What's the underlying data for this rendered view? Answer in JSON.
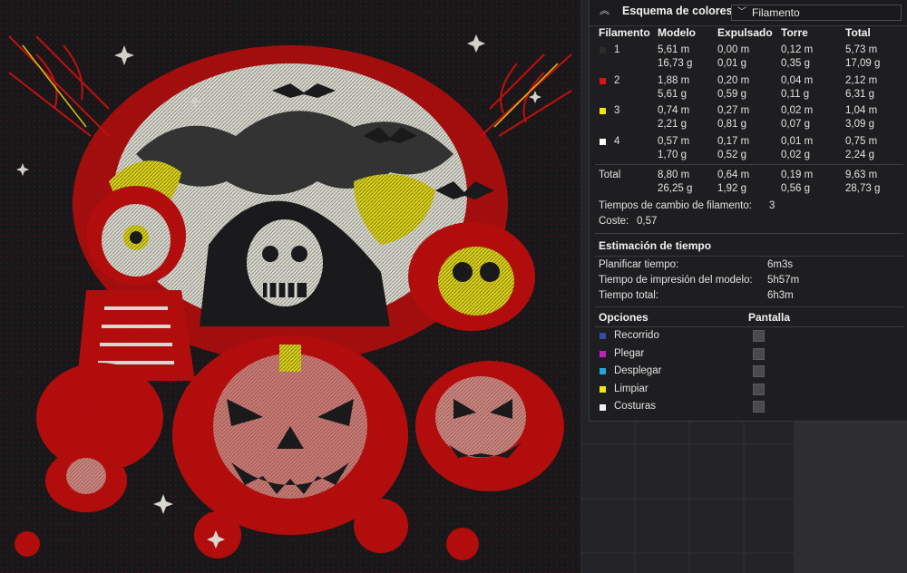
{
  "legend": {
    "title": "Esquema de colores",
    "view_mode": "Filamento",
    "headers": [
      "Filamento",
      "Modelo",
      "Expulsado",
      "Torre",
      "Total"
    ],
    "filaments": [
      {
        "id": "1",
        "color": "#2b2b2b",
        "modelo": [
          "5,61 m",
          "16,73 g"
        ],
        "expulsado": [
          "0,00 m",
          "0,01 g"
        ],
        "torre": [
          "0,12 m",
          "0,35 g"
        ],
        "total": [
          "5,73 m",
          "17,09 g"
        ]
      },
      {
        "id": "2",
        "color": "#e01010",
        "modelo": [
          "1,88 m",
          "5,61 g"
        ],
        "expulsado": [
          "0,20 m",
          "0,59 g"
        ],
        "torre": [
          "0,04 m",
          "0,11 g"
        ],
        "total": [
          "2,12 m",
          "6,31 g"
        ]
      },
      {
        "id": "3",
        "color": "#f2e600",
        "modelo": [
          "0,74 m",
          "2,21 g"
        ],
        "expulsado": [
          "0,27 m",
          "0,81 g"
        ],
        "torre": [
          "0,02 m",
          "0,07 g"
        ],
        "total": [
          "1,04 m",
          "3,09 g"
        ]
      },
      {
        "id": "4",
        "color": "#ffffff",
        "modelo": [
          "0,57 m",
          "1,70 g"
        ],
        "expulsado": [
          "0,17 m",
          "0,52 g"
        ],
        "torre": [
          "0,01 m",
          "0,02 g"
        ],
        "total": [
          "0,75 m",
          "2,24 g"
        ]
      }
    ],
    "total_row": {
      "label": "Total",
      "modelo": [
        "8,80 m",
        "26,25 g"
      ],
      "expulsado": [
        "0,64 m",
        "1,92 g"
      ],
      "torre": [
        "0,19 m",
        "0,56 g"
      ],
      "total": [
        "9,63 m",
        "28,73 g"
      ]
    },
    "filament_changes_label": "Tiempos de cambio de filamento:",
    "filament_changes_value": "3",
    "cost_label": "Coste:",
    "cost_value": "0,57"
  },
  "time_estimate": {
    "title": "Estimación de tiempo",
    "rows": [
      {
        "label": "Planificar tiempo:",
        "value": "6m3s"
      },
      {
        "label": "Tiempo de impresión del modelo:",
        "value": "5h57m"
      },
      {
        "label": "Tiempo total:",
        "value": "6h3m"
      }
    ]
  },
  "options": {
    "header_options": "Opciones",
    "header_display": "Pantalla",
    "items": [
      {
        "label": "Recorrido",
        "color": "#3a4aa0"
      },
      {
        "label": "Plegar",
        "color": "#c020c0"
      },
      {
        "label": "Desplegar",
        "color": "#20a8d8"
      },
      {
        "label": "Limpiar",
        "color": "#f0e800"
      },
      {
        "label": "Costuras",
        "color": "#f0f0f0"
      }
    ]
  },
  "colors": {
    "plate": "#1c1c1e",
    "red": "#c90f0f",
    "white": "#d8d8d0",
    "yellow": "#d9d020"
  }
}
